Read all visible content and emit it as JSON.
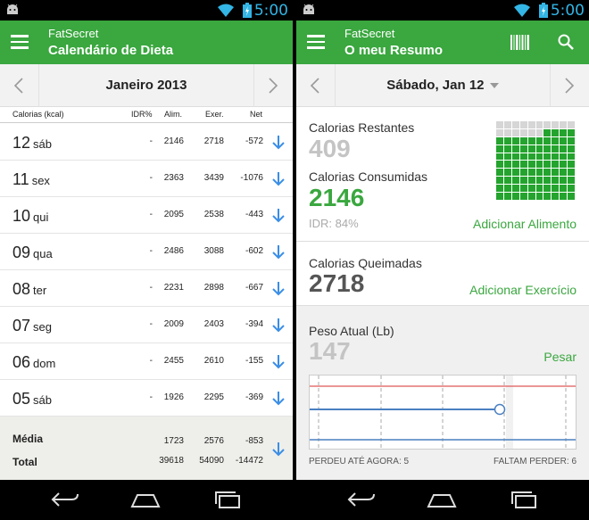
{
  "status_time": "5:00",
  "left": {
    "app_sub": "FatSecret",
    "app_title": "Calendário de Dieta",
    "month_label": "Janeiro 2013",
    "columns": {
      "calories": "Calorias (kcal)",
      "rdi": "IDR%",
      "food": "Alim.",
      "exercise": "Exer.",
      "net": "Net"
    },
    "rows": [
      {
        "day": "12",
        "dow": "sáb",
        "rdi": "-",
        "food": "2146",
        "exercise": "2718",
        "net": "-572"
      },
      {
        "day": "11",
        "dow": "sex",
        "rdi": "-",
        "food": "2363",
        "exercise": "3439",
        "net": "-1076"
      },
      {
        "day": "10",
        "dow": "qui",
        "rdi": "-",
        "food": "2095",
        "exercise": "2538",
        "net": "-443"
      },
      {
        "day": "09",
        "dow": "qua",
        "rdi": "-",
        "food": "2486",
        "exercise": "3088",
        "net": "-602"
      },
      {
        "day": "08",
        "dow": "ter",
        "rdi": "-",
        "food": "2231",
        "exercise": "2898",
        "net": "-667"
      },
      {
        "day": "07",
        "dow": "seg",
        "rdi": "-",
        "food": "2009",
        "exercise": "2403",
        "net": "-394"
      },
      {
        "day": "06",
        "dow": "dom",
        "rdi": "-",
        "food": "2455",
        "exercise": "2610",
        "net": "-155"
      },
      {
        "day": "05",
        "dow": "sáb",
        "rdi": "-",
        "food": "1926",
        "exercise": "2295",
        "net": "-369"
      }
    ],
    "average": {
      "label": "Média",
      "food": "1723",
      "exercise": "2576",
      "net": "-853"
    },
    "total": {
      "label": "Total",
      "food": "39618",
      "exercise": "54090",
      "net": "-14472"
    }
  },
  "right": {
    "app_sub": "FatSecret",
    "app_title": "O meu Resumo",
    "date_label": "Sábado, Jan 12",
    "remaining_label": "Calorias Restantes",
    "remaining_value": "409",
    "consumed_label": "Calorias Consumidas",
    "consumed_value": "2146",
    "rdi_text": "IDR: 84%",
    "add_food": "Adicionar Alimento",
    "burned_label": "Calorias Queimadas",
    "burned_value": "2718",
    "add_exercise": "Adicionar Exercício",
    "weight_label": "Peso Atual (Lb)",
    "weight_value": "147",
    "weigh_link": "Pesar",
    "lost_so_far": "PERDEU ATÉ AGORA: 5",
    "left_to_lose": "FALTAM PERDER: 6",
    "grid_filled": 84,
    "colors": {
      "accent": "#3aa73f",
      "grid_fill": "#24a42e",
      "grid_empty": "#d6d6d6",
      "goal_line": "#e57373",
      "weight_line": "#4a7fc1"
    }
  }
}
